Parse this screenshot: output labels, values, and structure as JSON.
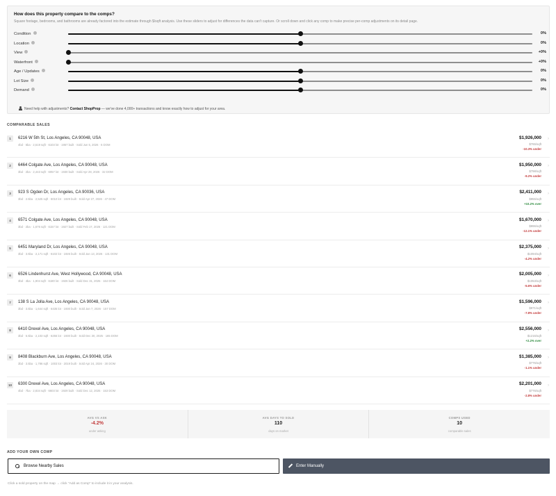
{
  "adjust": {
    "title": "How does this property compare to the comps?",
    "description": "Square footage, bedrooms, and bathrooms are already factored into the estimate through $/sqft analysis. Use these sliders to adjust for differences the data can't capture. Or scroll down and click any comp to make precise per-comp adjustments on its detail page.",
    "sliders": [
      {
        "label": "Condition",
        "value": "0%",
        "position": 0.5
      },
      {
        "label": "Location",
        "value": "0%",
        "position": 0.5
      },
      {
        "label": "View",
        "value": "+0%",
        "position": 0.0
      },
      {
        "label": "Waterfront",
        "value": "+0%",
        "position": 0.0
      },
      {
        "label": "Age / Updates",
        "value": "0%",
        "position": 0.5
      },
      {
        "label": "Lot Size",
        "value": "0%",
        "position": 0.5
      },
      {
        "label": "Demand",
        "value": "0%",
        "position": 0.5
      }
    ],
    "help_prefix": "Need help with adjustments?",
    "help_link": "Contact ShopProp",
    "help_suffix": "— we've done 4,000+ transactions and know exactly how to adjust for your area."
  },
  "comps_heading": "COMPARABLE SALES",
  "comps": [
    {
      "num": "1",
      "address": "6216 W 5th St, Los Angeles, CA 90048, USA",
      "details": "4bd · 5ba · 2,519 sqft · 6103 lot · 1957 built · Sold Jun 5, 2026 · 6 DOM",
      "price": "$1,926,000",
      "psf": "$765/sqft",
      "diff": "-10.3% under",
      "dir": "under"
    },
    {
      "num": "2",
      "address": "6464 Colgate Ave, Los Angeles, CA 90048, USA",
      "details": "3bd · 2ba · 2,443 sqft · 6057 lot · 1930 built · Sold Apr 28, 2026 · 32 DOM",
      "price": "$1,950,000",
      "psf": "$798/sqft",
      "diff": "-9.2% under",
      "dir": "under"
    },
    {
      "num": "3",
      "address": "923 S Ogden Dr, Los Angeles, CA 90036, USA",
      "details": "3bd · 2.5ba · 2,525 sqft · 6010 lot · 1929 built · Sold Apr 27, 2026 · 47 DOM",
      "price": "$2,411,000",
      "psf": "$955/sqft",
      "diff": "+10.2% over",
      "dir": "over"
    },
    {
      "num": "4",
      "address": "6571 Colgate Ave, Los Angeles, CA 90048, USA",
      "details": "3bd · 2ba · 1,676 sqft · 6157 lot · 1927 built · Sold Feb 17, 2026 · 121 DOM",
      "price": "$1,670,000",
      "psf": "$996/sqft",
      "diff": "-12.1% under",
      "dir": "under"
    },
    {
      "num": "5",
      "address": "6451 Maryland Dr, Los Angeles, CA 90048, USA",
      "details": "3bd · 3.5ba · 2,171 sqft · 6102 lot · 1926 built · Sold Jan 13, 2026 · 131 DOM",
      "price": "$2,375,000",
      "psf": "$1094/sqft",
      "diff": "-4.2% under",
      "dir": "under"
    },
    {
      "num": "6",
      "address": "6526 Lindenhurst Ave, West Hollywood, CA 90048, USA",
      "details": "3bd · 4ba · 1,904 sqft · 6180 lot · 1926 built · Sold Dec 31, 2025 · 164 DOM",
      "price": "$2,005,000",
      "psf": "$1053/sqft",
      "diff": "-5.6% under",
      "dir": "under"
    },
    {
      "num": "7",
      "address": "138 S La Jolla Ave, Los Angeles, CA 90048, USA",
      "details": "3bd · 3.5ba · 1,644 sqft · 6435 lot · 1930 built · Sold Jan 7, 2026 · 157 DOM",
      "price": "$1,596,000",
      "psf": "$971/sqft",
      "diff": "-7.8% under",
      "dir": "under"
    },
    {
      "num": "8",
      "address": "6410 Drexel Ave, Los Angeles, CA 90048, USA",
      "details": "3bd · 5.5ba · 2,103 sqft · 6255 lot · 1930 built · Sold Dec 30, 2025 · 165 DOM",
      "price": "$2,556,000",
      "psf": "$1215/sqft",
      "diff": "+2.2% over",
      "dir": "over"
    },
    {
      "num": "9",
      "address": "8408 Blackburn Ave, Los Angeles, CA 90048, USA",
      "details": "3bd · 3.5ba · 1,786 sqft · 1003 lot · 2019 built · Sold Apr 24, 2026 · 30 DOM",
      "price": "$1,385,000",
      "psf": "$775/sqft",
      "diff": "-1.1% under",
      "dir": "under"
    },
    {
      "num": "10",
      "address": "6300 Drexel Ave, Los Angeles, CA 90048, USA",
      "details": "4bd · 7ba · 2,834 sqft · 6603 lot · 1929 built · Sold Dec 12, 2025 · 153 DOM",
      "price": "$2,201,000",
      "psf": "$776/sqft",
      "diff": "-2.8% under",
      "dir": "under"
    }
  ],
  "stats": [
    {
      "label": "AVG VS ASK",
      "value": "-4.2%",
      "sub": "under asking",
      "negative": true
    },
    {
      "label": "AVG DAYS TO SOLD",
      "value": "110",
      "sub": "days on market",
      "negative": false
    },
    {
      "label": "COMPS USED",
      "value": "10",
      "sub": "comparable sales",
      "negative": false
    }
  ],
  "add_comp": {
    "heading": "ADD YOUR OWN COMP",
    "browse_label": "Browse Nearby Sales",
    "manual_label": "Enter Manually",
    "hint": "Click a sold property on the map → click \"Add as Comp\" to include it in your analysis."
  }
}
